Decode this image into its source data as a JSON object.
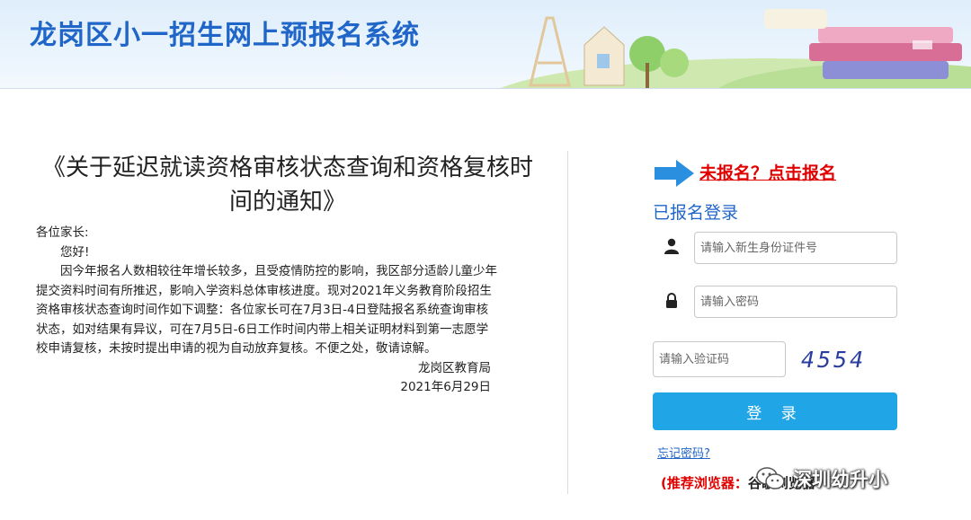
{
  "header": {
    "title": "龙岗区小一招生网上预报名系统"
  },
  "notice": {
    "title": "《关于延迟就读资格审核状态查询和资格复核时间的通知》",
    "salutation": "各位家长:",
    "greeting": "您好!",
    "body": "因今年报名人数相较往年增长较多，且受疫情防控的影响，我区部分适龄儿童少年提交资料时间有所推迟，影响入学资料总体审核进度。现对2021年义务教育阶段招生资格审核状态查询时间作如下调整：各位家长可在7月3日-4日登陆报名系统查询审核状态，如对结果有异议，可在7月5日-6日工作时间内带上相关证明材料到第一志愿学校申请复核，未按时提出申请的视为自动放弃复核。不便之处，敬请谅解。",
    "signature": "龙岗区教育局",
    "date": "2021年6月29日"
  },
  "login": {
    "register_link": "未报名？点击报名",
    "heading": "已报名登录",
    "id_placeholder": "请输入新生身份证件号",
    "password_placeholder": "请输入密码",
    "captcha_placeholder": "请输入验证码",
    "captcha_code": "4554",
    "login_button": "登 录",
    "forgot_password": "忘记密码?",
    "browser_tip_prefix": "(推荐浏览器：",
    "browser_tip_name": "谷歌浏览器"
  },
  "watermark": {
    "text": "深圳幼升小"
  },
  "icons": {
    "arrow": "arrow-right-icon",
    "user": "user-icon",
    "lock": "lock-icon",
    "wechat": "wechat-icon"
  },
  "colors": {
    "brand_blue": "#1f66c8",
    "button_blue": "#20a6e6",
    "alert_red": "#e00000"
  }
}
